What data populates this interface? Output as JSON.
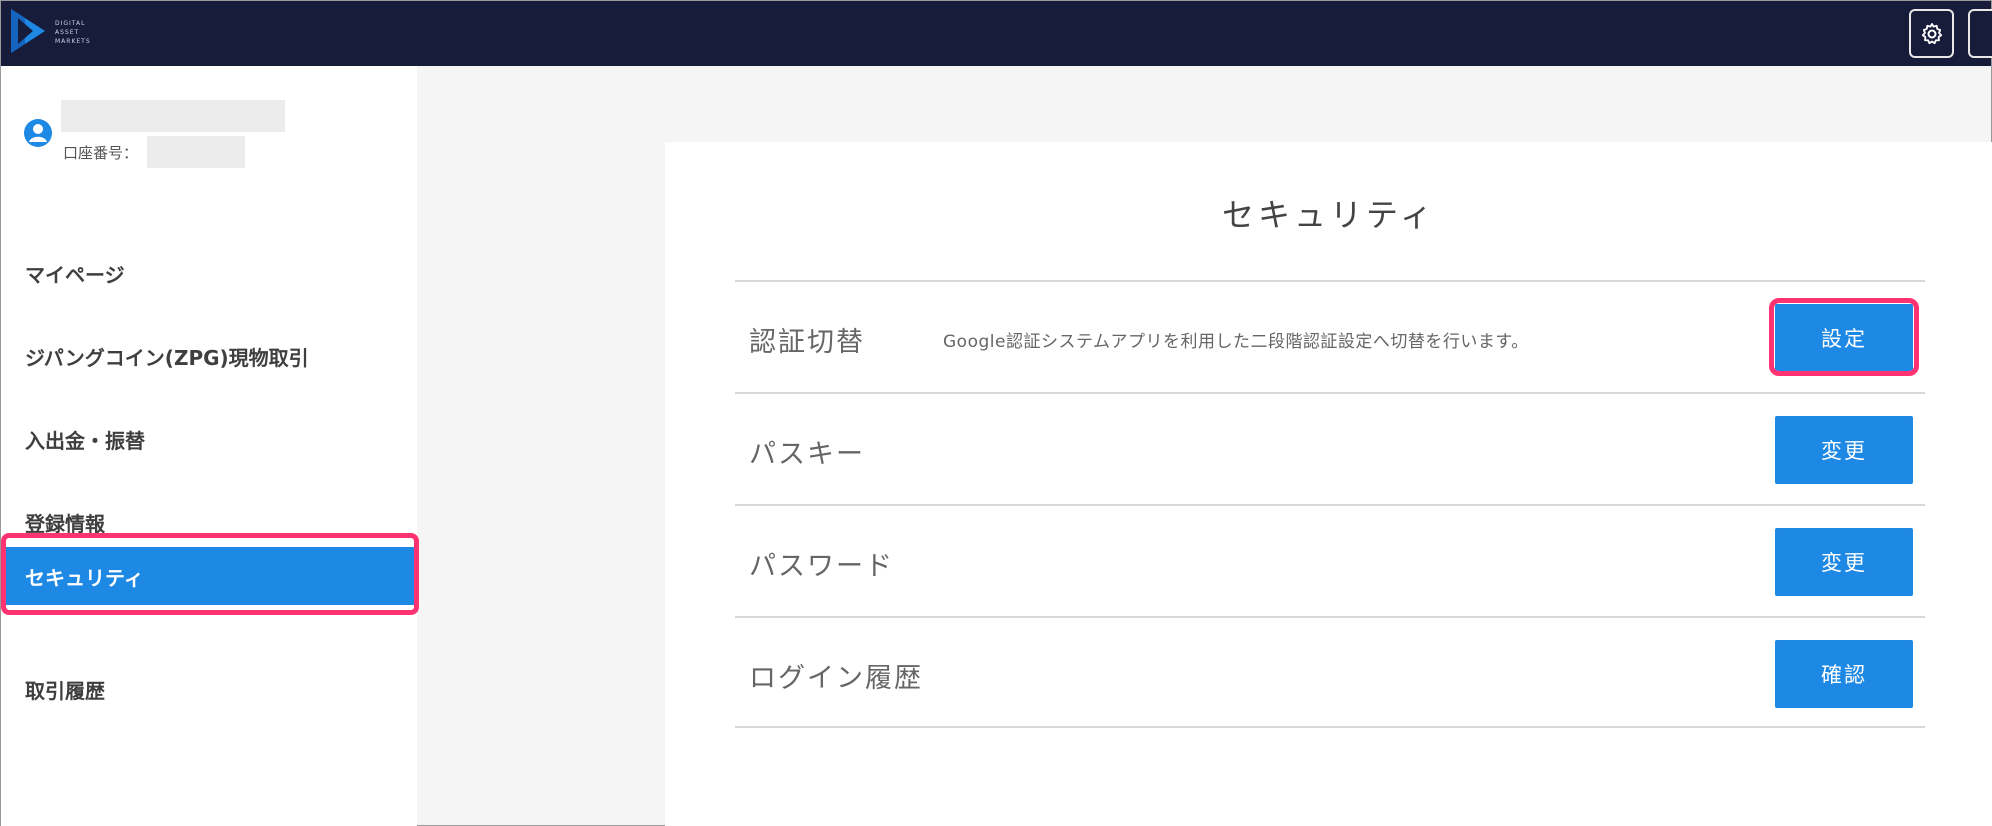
{
  "header": {
    "logo_lines": [
      "DIGITAL",
      "ASSET",
      "MARKETS"
    ],
    "settings_icon": "gear-icon"
  },
  "sidebar": {
    "account_label": "口座番号：",
    "items": [
      {
        "label": "マイページ"
      },
      {
        "label": "ジパングコイン(ZPG)現物取引"
      },
      {
        "label": "入出金・振替"
      },
      {
        "label": "登録情報"
      },
      {
        "label": "セキュリティ"
      },
      {
        "label": "取引履歴"
      }
    ]
  },
  "main": {
    "title": "セキュリティ",
    "rows": [
      {
        "label": "認証切替",
        "description": "Google認証システムアプリを利用した二段階認証設定へ切替を行います。",
        "button": "設定"
      },
      {
        "label": "パスキー",
        "description": "",
        "button": "変更"
      },
      {
        "label": "パスワード",
        "description": "",
        "button": "変更"
      },
      {
        "label": "ログイン履歴",
        "description": "",
        "button": "確認"
      }
    ]
  },
  "colors": {
    "topbar": "#171c3a",
    "accent": "#1e88e5",
    "highlight": "#ff3372"
  }
}
